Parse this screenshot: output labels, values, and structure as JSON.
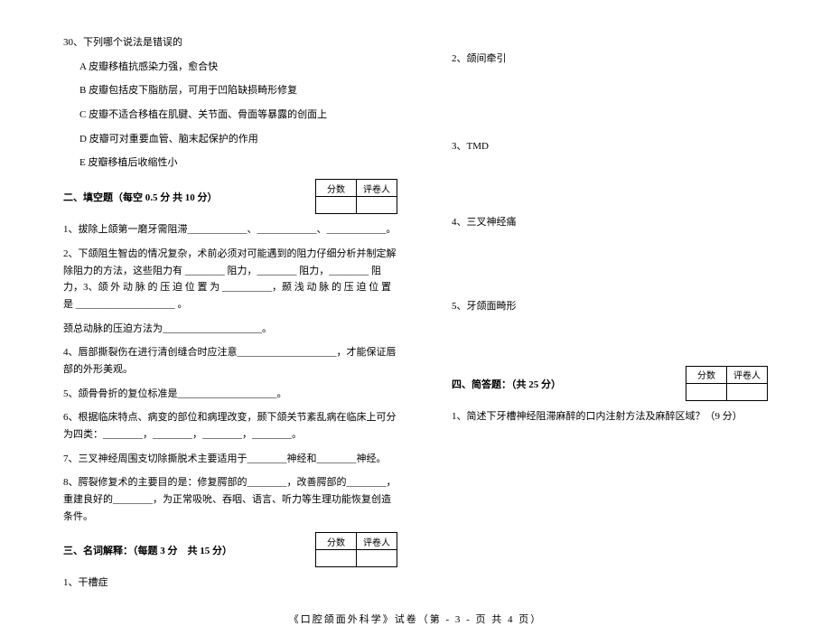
{
  "score_table": {
    "col1": "分数",
    "col2": "评卷人"
  },
  "left": {
    "q30": {
      "stem": "30、下列哪个说法是错误的",
      "a": "A 皮瓣移植抗感染力强，愈合快",
      "b": "B 皮瓣包括皮下脂肪层，可用于凹陷缺损畸形修复",
      "c": "C 皮瓣不适合移植在肌腱、关节面、骨面等暴露的创面上",
      "d": "D 皮瓣可对重要血管、脑末起保护的作用",
      "e": "E 皮瓣移植后收缩性小"
    },
    "sec2_title": "二、填空题（每空 0.5 分 共 10 分）",
    "fill_1": "1、拔除上颌第一磨牙需阻滞____________、____________、____________。",
    "fill_2": "2、下颌阻生智齿的情况复杂，术前必须对可能遇到的阻力仔细分析并制定解除阻力的方法，这些阻力有 ________ 阻力，________ 阻力，________ 阻力，3、颌 外 动 脉 的 压 迫 位 置 为 __________，颞 浅 动 脉 的 压 迫 位 置 是 ____________________ 。",
    "fill_3b": "颈总动脉的压迫方法为____________________。",
    "fill_4": "4、唇部撕裂伤在进行清创缝合时应注意____________________，才能保证唇部的外形美观。",
    "fill_5": "5、颌骨骨折的复位标准是____________________。",
    "fill_6": "6、根据临床特点、病变的部位和病理改变，颞下颌关节紊乱病在临床上可分为四类：________，________，________，________。",
    "fill_7": "7、三叉神经周围支切除撕脱术主要适用于________神经和________神经。",
    "fill_8": "8、腭裂修复术的主要目的是：修复腭部的________，改善腭部的________，重建良好的________，为正常吸吮、吞咽、语言、听力等生理功能恢复创造条件。",
    "sec3_title": "三、名词解释：（每题 3 分　共 15 分）",
    "term_1": "1、干槽症"
  },
  "right": {
    "term_2": "2、颌间牵引",
    "term_3": "3、TMD",
    "term_4": "4、三叉神经痛",
    "term_5": "5、牙颌面畸形",
    "sec4_title": "四、简答题：（共 25 分）",
    "short_1": "1、简述下牙槽神经阻滞麻醉的口内注射方法及麻醉区域？（9 分）"
  },
  "footer": "《口腔颌面外科学》试卷（第 - 3 - 页 共 4 页）"
}
